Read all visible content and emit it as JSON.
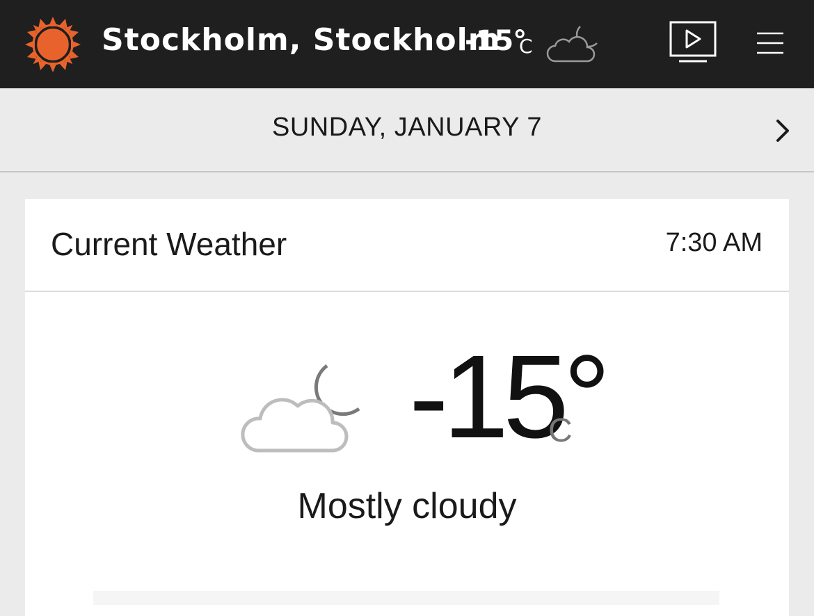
{
  "header": {
    "location": "Stockholm, Stockholm",
    "temperature": "-15°",
    "unit": "C",
    "condition_icon": "cloud-moon-icon",
    "video_icon": "video-play-icon",
    "menu_icon": "hamburger-menu-icon",
    "logo_icon": "sun-logo-icon"
  },
  "date_bar": {
    "label": "SUNDAY, JANUARY 7",
    "next_icon": "chevron-right-icon"
  },
  "current_weather": {
    "title": "Current Weather",
    "time": "7:30 AM",
    "temperature": "-15°",
    "unit": "C",
    "condition": "Mostly cloudy",
    "condition_icon": "cloud-moon-icon"
  },
  "colors": {
    "topbar_bg": "#1f1f1f",
    "accent_orange": "#e8632b",
    "page_bg": "#ebebeb",
    "card_bg": "#ffffff"
  }
}
